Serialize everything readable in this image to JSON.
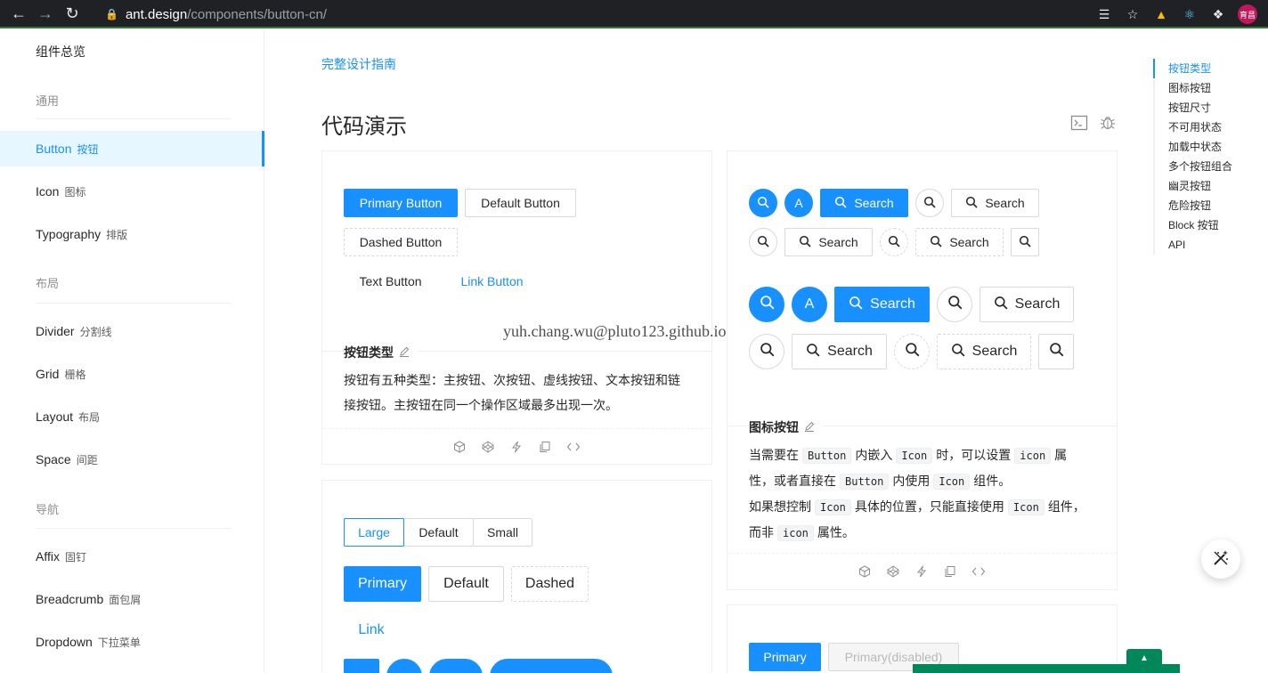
{
  "browser": {
    "url_host": "ant.design",
    "url_path": "/components/button-cn/",
    "profile_label": "育昌"
  },
  "sidebar": {
    "title": "组件总览",
    "groups": [
      {
        "label": "通用"
      },
      {
        "label": "布局"
      },
      {
        "label": "导航"
      }
    ],
    "items": [
      {
        "en": "Button",
        "cn": "按钮"
      },
      {
        "en": "Icon",
        "cn": "图标"
      },
      {
        "en": "Typography",
        "cn": "排版"
      },
      {
        "en": "Divider",
        "cn": "分割线"
      },
      {
        "en": "Grid",
        "cn": "栅格"
      },
      {
        "en": "Layout",
        "cn": "布局"
      },
      {
        "en": "Space",
        "cn": "间距"
      },
      {
        "en": "Affix",
        "cn": "固钉"
      },
      {
        "en": "Breadcrumb",
        "cn": "面包屑"
      },
      {
        "en": "Dropdown",
        "cn": "下拉菜单"
      }
    ]
  },
  "main": {
    "guide_link": "完整设计指南",
    "section_title": "代码演示"
  },
  "demo_types": {
    "buttons": {
      "primary": "Primary Button",
      "default": "Default Button",
      "dashed": "Dashed Button",
      "text": "Text Button",
      "link": "Link Button"
    },
    "title": "按钮类型",
    "desc_line1": "按钮有五种类型：主按钮、次按钮、虚线按钮、文本按钮和链",
    "desc_line2": "接按钮。主按钮在同一个操作区域最多出现一次。"
  },
  "demo_icons": {
    "avatar_letter": "A",
    "search": "Search",
    "title": "图标按钮",
    "desc": {
      "p1a": "当需要在",
      "code_button": "Button",
      "p1b": "内嵌入",
      "code_icon": "Icon",
      "p1c": "时，可以设置",
      "code_icon_prop": "icon",
      "p1d": "属",
      "p2a": "性，或者直接在",
      "p2b": "内使用",
      "p2c": "组件。",
      "p3a": "如果想控制",
      "p3b": "具体的位置，只能直接使用",
      "p3c": "组件，",
      "p4a": "而非",
      "p4b": "属性。"
    }
  },
  "demo_size": {
    "seg_large": "Large",
    "seg_default": "Default",
    "seg_small": "Small",
    "primary": "Primary",
    "default": "Default",
    "dashed": "Dashed",
    "link": "Link"
  },
  "demo_disabled": {
    "primary": "Primary",
    "primary_disabled": "Primary(disabled)"
  },
  "toc": [
    "按钮类型",
    "图标按钮",
    "按钮尺寸",
    "不可用状态",
    "加载中状态",
    "多个按钮组合",
    "幽灵按钮",
    "危险按钮",
    "Block 按钮",
    "API"
  ],
  "watermark": "yuh.chang.wu@pluto123.github.io",
  "colors": {
    "primary": "#1890ff",
    "active_bg": "#e6f7ff"
  }
}
